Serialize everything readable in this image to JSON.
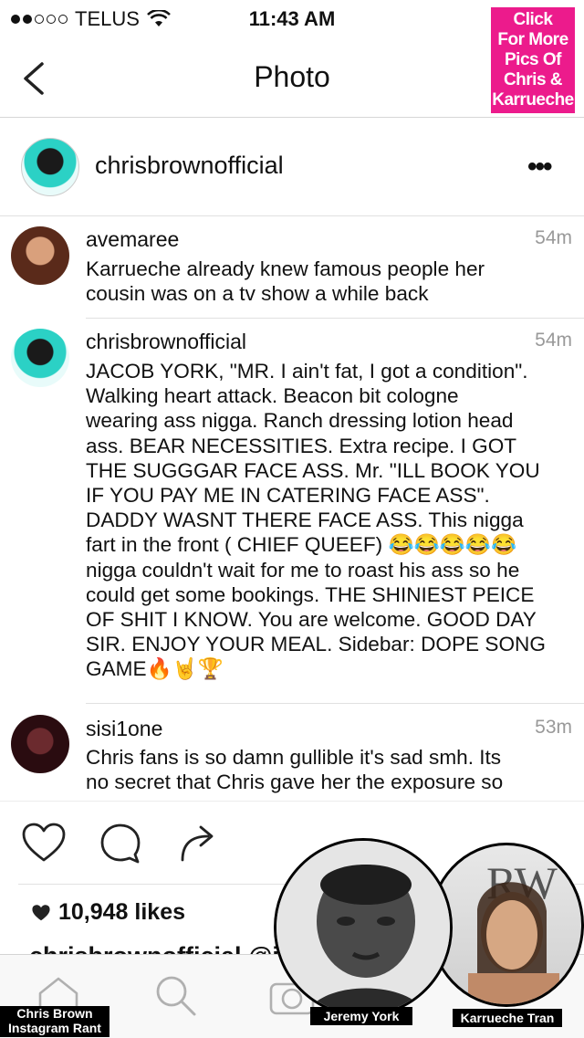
{
  "status_bar": {
    "carrier": "TELUS",
    "time": "11:43 AM"
  },
  "nav": {
    "title": "Photo"
  },
  "promo": {
    "lines": [
      "Click",
      "For More",
      "Pics Of",
      "Chris &",
      "Karrueche"
    ],
    "color": "#ec1b8c"
  },
  "post": {
    "username": "chrisbrownofficial",
    "more": "•••"
  },
  "comments": [
    {
      "user": "avemaree",
      "time": "54m",
      "text": "Karrueche already knew famous people her\ncousin was on a tv show a while back"
    },
    {
      "user": "chrisbrownofficial",
      "time": "54m",
      "text": "JACOB YORK, \"MR. I ain't fat, I got a condition\".\nWalking heart attack. Beacon bit cologne\nwearing ass nigga. Ranch dressing lotion head\nass. BEAR NECESSITIES. Extra recipe. I GOT\nTHE SUGGGAR FACE ASS. Mr. \"ILL BOOK YOU\nIF YOU PAY ME IN CATERING FACE ASS\".\nDADDY WASNT THERE FACE ASS. This nigga\nfart in the front ( CHIEF QUEEF) 😂😂😂😂😂\nnigga couldn't wait for me to roast his ass so he\ncould get some bookings. THE SHINIEST PEICE\nOF SHIT I KNOW. You are welcome. GOOD DAY\nSIR. ENJOY YOUR MEAL. Sidebar: DOPE SONG\nGAME🔥🤘🏆"
    },
    {
      "user": "sisi1one",
      "time": "53m",
      "text": "Chris fans is so damn gullible it's sad smh. Its\nno secret that Chris gave her the exposure so"
    }
  ],
  "likes": {
    "count_text": "10,948 likes"
  },
  "caption_partial": "chrisbrownofficial @i",
  "overlays": {
    "left_label": [
      "Chris Brown",
      "Instagram Rant"
    ],
    "person1_label": "Jeremy York",
    "person2_label": "Karrueche Tran"
  }
}
